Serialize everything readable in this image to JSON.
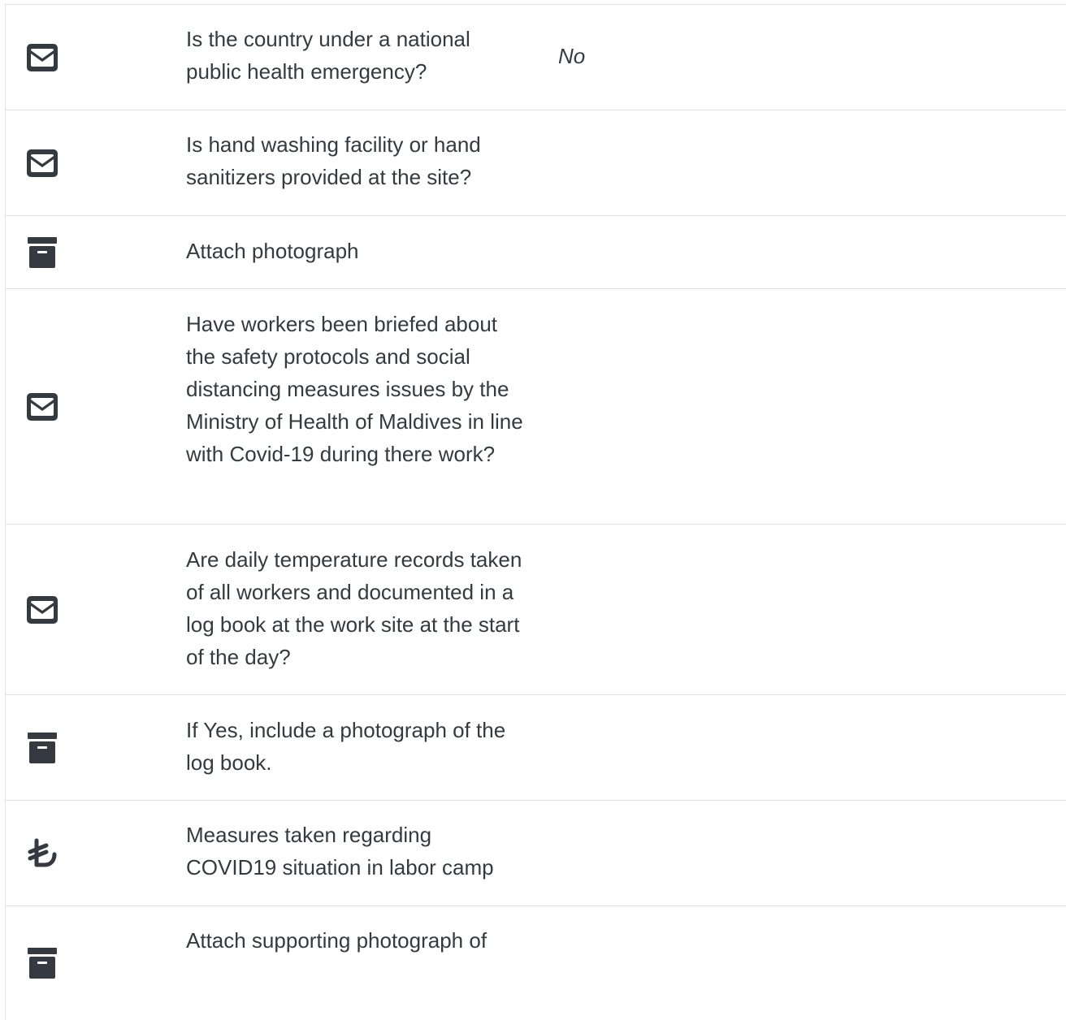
{
  "rows": [
    {
      "icon": "envelope-icon",
      "question": "Is the country under a national public health emergency?",
      "answer": "No"
    },
    {
      "icon": "envelope-icon",
      "question": "Is hand washing facility or hand sanitizers provided at the site?",
      "answer": ""
    },
    {
      "icon": "archive-box-icon",
      "question": "Attach photograph",
      "answer": ""
    },
    {
      "icon": "envelope-icon",
      "question": "Have workers been briefed about the safety protocols and social distancing measures issues by the Ministry of Health of Maldives in line with Covid-19 during there work?",
      "answer": ""
    },
    {
      "icon": "envelope-icon",
      "question": "Are daily temperature records taken of all workers and documented in a log book at the work site at the start of the day?",
      "answer": ""
    },
    {
      "icon": "archive-box-icon",
      "question": "If Yes, include a photograph of the log book.",
      "answer": ""
    },
    {
      "icon": "lira-sign-icon",
      "question": "Measures taken regarding COVID19 situation in labor camp",
      "answer": ""
    },
    {
      "icon": "archive-box-icon",
      "question": "Attach supporting photograph of",
      "answer": ""
    }
  ],
  "colors": {
    "text": "#343a40",
    "icon": "#343a40",
    "border": "#dee2e6"
  }
}
